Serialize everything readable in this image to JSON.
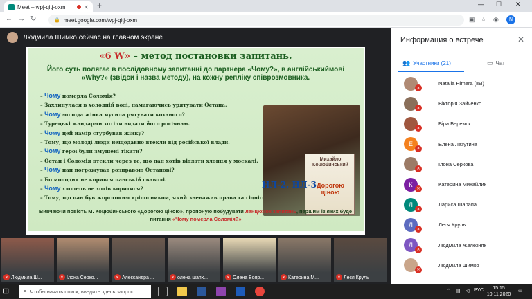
{
  "browser": {
    "tab_title": "Meet – wpj-qitj-oxm",
    "url": "meet.google.com/wpj-qitj-oxm",
    "profile_initial": "N"
  },
  "stage": {
    "presenter_text": "Людмила Шимко сейчас на главном экране"
  },
  "slide": {
    "title_highlight": "«6 W»",
    "title_rest": " – метод постановки запитань.",
    "subtitle": "Його суть полягає в послідовному запитанні до партнера «Чому?», в англійськиймові «Why?» (звідси і назва методу), на кожну репліку співрозмовника.",
    "lines": [
      {
        "q": "Чому",
        "text": " померла Соломія?"
      },
      {
        "q": "",
        "text": "Захлинулася в холодній воді, намагаючись урятувати Остапа."
      },
      {
        "q": "Чому",
        "text": " молода жінка мусила рятувати коханого?"
      },
      {
        "q": "",
        "text": "Турецькі жандарми хотіли видати його росіянам."
      },
      {
        "q": "Чому",
        "text": " цей намір стурбував жінку?"
      },
      {
        "q": "",
        "text": "Тому, що молоді люди нещодавно втекли від російської влади."
      },
      {
        "q": "Чому",
        "text": " герої були змушені тікати?"
      },
      {
        "q": "",
        "text": "Остап і Соломія втекли через те, що пан хотів віддати хлопця у москалі."
      },
      {
        "q": "Чому",
        "text": " пан погрожував розправою Остапові?"
      },
      {
        "q": "",
        "text": "Бо молодик не корився панській сваволі."
      },
      {
        "q": "Чому",
        "text": " хлопець не хотів коритися?"
      },
      {
        "q": "",
        "text": "Тому, що пан був жорстоким кріпосником, який зневажав права та гідність людини."
      }
    ],
    "book_author": "Михайло Коцюбинський",
    "book_title": "Дорогою ціною",
    "nl_label": "НЛ-2, НЛ-3",
    "footer_part1": "Вивчаючи повість М. Коцюбинського «Дорогою ціною», пропоную побудувати ",
    "footer_red1": "ланцюжок запитань",
    "footer_part2": ", першим із яких буде питання ",
    "footer_red2": "«Чому померла Соломія?»"
  },
  "panel": {
    "title": "Информация о встрече",
    "tab_participants": "Участники (21)",
    "tab_chat": "Чат",
    "participants": [
      {
        "name": "Natalia Himera (вы)",
        "initial": "",
        "color": "#b08a74",
        "photo": true
      },
      {
        "name": "Вікторія Зайченко",
        "initial": "",
        "color": "#8a6f5a",
        "photo": true
      },
      {
        "name": "Віра Березюк",
        "initial": "",
        "color": "#a0573f",
        "photo": true
      },
      {
        "name": "Елена Лазутина",
        "initial": "Е",
        "color": "#f4811f",
        "photo": false
      },
      {
        "name": "Ілона Серкова",
        "initial": "",
        "color": "#9c7b66",
        "photo": true
      },
      {
        "name": "Катерина Михайлик",
        "initial": "К",
        "color": "#7b1fa2",
        "photo": false
      },
      {
        "name": "Лариса Шарапа",
        "initial": "Л",
        "color": "#00897b",
        "photo": false
      },
      {
        "name": "Леся Круль",
        "initial": "Л",
        "color": "#5c6bc0",
        "photo": false
      },
      {
        "name": "Людмила Железняк",
        "initial": "Л",
        "color": "#7e57c2",
        "photo": false
      },
      {
        "name": "Людмила Шимко",
        "initial": "",
        "color": "#c9a58a",
        "photo": true
      }
    ]
  },
  "filmstrip": [
    {
      "name": "Людмила Ш...",
      "color": "#8d5a4a"
    },
    {
      "name": "Ілона Серко...",
      "color": "#b08c70"
    },
    {
      "name": "Александра ...",
      "color": "#6d5a4e"
    },
    {
      "name": "олена шаях...",
      "color": "#9a8a7e"
    },
    {
      "name": "Олена Бояр...",
      "color": "#e8d9b5"
    },
    {
      "name": "Катерина М...",
      "color": "#8a7868"
    },
    {
      "name": "Леся Круль",
      "color": "#5a4a40"
    }
  ],
  "taskbar": {
    "search_placeholder": "Чтобы начать поиск, введите здесь запрос",
    "lang": "РУС",
    "time": "15:15",
    "date": "10.11.2020"
  }
}
